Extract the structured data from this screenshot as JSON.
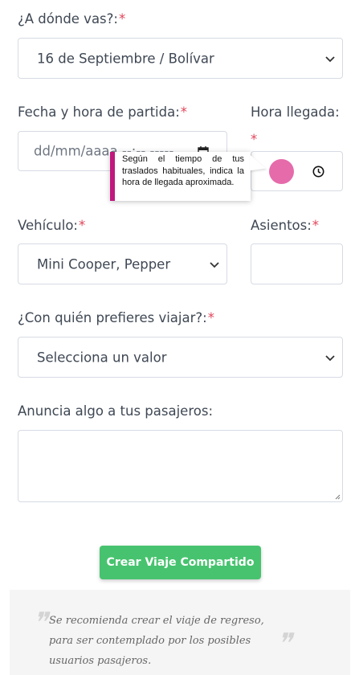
{
  "form": {
    "destino": {
      "label": "¿A dónde vas?:",
      "required": "*",
      "value": "16 de Septiembre / Bolívar"
    },
    "fecha": {
      "label": "Fecha y hora de partida:",
      "required": "*",
      "placeholder": "dd/mm/aaaa --:-- -----"
    },
    "llegada": {
      "label": "Hora llegada:",
      "required": "*",
      "value": "--:--"
    },
    "vehiculo": {
      "label": "Vehículo:",
      "required": "*",
      "value": "Mini Cooper, Pepper"
    },
    "asientos": {
      "label": "Asientos:",
      "required": "*",
      "value": ""
    },
    "preferencia": {
      "label": "¿Con quién prefieres viajar?:",
      "required": "*",
      "value": "Selecciona un valor"
    },
    "anuncio": {
      "label": "Anuncia algo a tus pasajeros:",
      "value": ""
    }
  },
  "tooltip": {
    "text": "Según el tiempo de tus traslados habituales, indica la hora de llegada aproximada."
  },
  "submit": {
    "label": "Crear Viaje Compartido"
  },
  "note": {
    "text": "Se recomienda crear el viaje de regreso, para ser contemplado por los posibles usuarios pasajeros."
  },
  "icons": {
    "select": "chevron-down-icon",
    "calendar": "calendar-icon",
    "clock": "clock-icon"
  },
  "colors": {
    "required": "#e0455a",
    "button": "#47c36f",
    "tooltip_accent": "#c0187d",
    "highlight": "#e66bab"
  }
}
